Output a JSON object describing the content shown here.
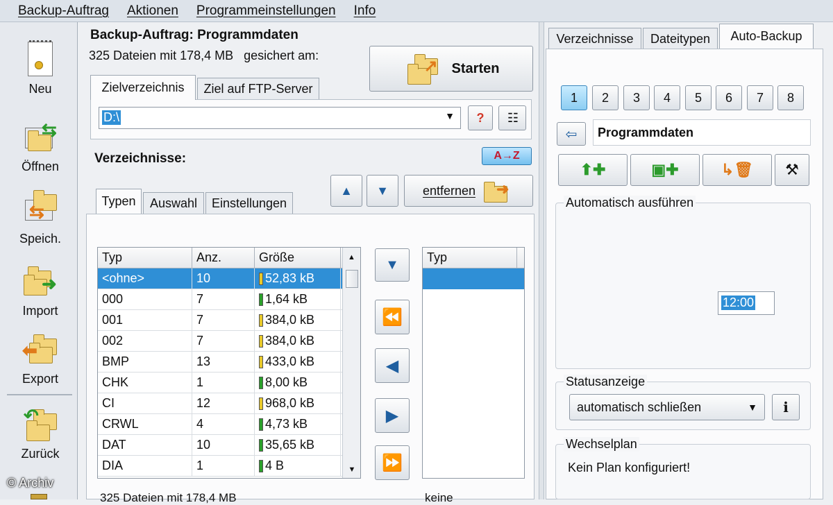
{
  "menu": [
    "Backup-Auftrag",
    "Aktionen",
    "Programmeinstellungen",
    "Info"
  ],
  "toolbar": [
    {
      "label": "Neu",
      "icon": "new-document-icon"
    },
    {
      "label": "Öffnen",
      "icon": "open-icon"
    },
    {
      "label": "Speich.",
      "icon": "save-icon"
    },
    {
      "label": "Import",
      "icon": "import-icon"
    },
    {
      "label": "Export",
      "icon": "export-icon"
    },
    {
      "label": "Zurück",
      "icon": "back-icon"
    }
  ],
  "job": {
    "title": "Backup-Auftrag: Programmdaten",
    "summary": "325 Dateien mit 178,4 MB   gesichert am:",
    "start_label": "Starten"
  },
  "target_tabs": [
    "Zielverzeichnis",
    "Ziel auf FTP-Server"
  ],
  "target": {
    "value": "D:\\",
    "help_label": "?"
  },
  "directories_label": "Verzeichnisse:",
  "sort_label": "A→Z",
  "remove_label": "entfernen",
  "type_tabs": [
    "Typen",
    "Auswahl",
    "Einstellungen"
  ],
  "types_table": {
    "headers": [
      "Typ",
      "Anz.",
      "Größe"
    ],
    "rows": [
      {
        "typ": "<ohne>",
        "anz": "10",
        "size": "52,83 kB",
        "bar": "#e8c92a"
      },
      {
        "typ": "000",
        "anz": "7",
        "size": "1,64 kB",
        "bar": "#2aa02a"
      },
      {
        "typ": "001",
        "anz": "7",
        "size": "384,0 kB",
        "bar": "#e8c92a"
      },
      {
        "typ": "002",
        "anz": "7",
        "size": "384,0 kB",
        "bar": "#e8c92a"
      },
      {
        "typ": "BMP",
        "anz": "13",
        "size": "433,0 kB",
        "bar": "#e8c92a"
      },
      {
        "typ": "CHK",
        "anz": "1",
        "size": "8,00 kB",
        "bar": "#2aa02a"
      },
      {
        "typ": "CI",
        "anz": "12",
        "size": "968,0 kB",
        "bar": "#e8c92a"
      },
      {
        "typ": "CRWL",
        "anz": "4",
        "size": "4,73 kB",
        "bar": "#2aa02a"
      },
      {
        "typ": "DAT",
        "anz": "10",
        "size": "35,65 kB",
        "bar": "#2aa02a"
      },
      {
        "typ": "DIA",
        "anz": "1",
        "size": "4 B",
        "bar": "#2aa02a"
      }
    ],
    "footer": "325 Dateien mit 178,4 MB"
  },
  "selected_table": {
    "header": "Typ",
    "footer": "keine"
  },
  "right_tabs": [
    "Verzeichnisse",
    "Dateitypen",
    "Auto-Backup"
  ],
  "slots": [
    "1",
    "2",
    "3",
    "4",
    "5",
    "6",
    "7",
    "8"
  ],
  "auto_name": "Programmdaten",
  "auto_run": {
    "label": "Automatisch ausführen",
    "time": "12:00"
  },
  "status": {
    "label": "Statusanzeige",
    "value": "automatisch schließen"
  },
  "rotation": {
    "label": "Wechselplan",
    "text": "Kein Plan konfiguriert!"
  },
  "watermark": "© Archiv"
}
